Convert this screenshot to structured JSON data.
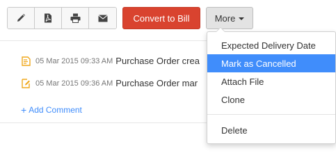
{
  "toolbar": {
    "icons": {
      "edit": "pencil-icon",
      "pdf": "pdf-icon",
      "print": "printer-icon",
      "email": "envelope-icon"
    },
    "convert_label": "Convert to Bill",
    "more_label": "More"
  },
  "history": [
    {
      "icon": "note-icon",
      "timestamp": "05 Mar 2015 09:33 AM",
      "message": "Purchase Order crea"
    },
    {
      "icon": "edit-note-icon",
      "timestamp": "05 Mar 2015 09:36 AM",
      "message": "Purchase Order mar"
    }
  ],
  "add_comment_label": "Add Comment",
  "more_menu": {
    "items": [
      {
        "label": "Expected Delivery Date",
        "active": false
      },
      {
        "label": "Mark as Cancelled",
        "active": true
      },
      {
        "label": "Attach File",
        "active": false
      },
      {
        "label": "Clone",
        "active": false
      },
      {
        "label": "Delete",
        "active": false
      }
    ]
  },
  "colors": {
    "primary_button": "#d9432f",
    "accent_blue": "#408dfb",
    "history_icon": "#f0a81c"
  }
}
